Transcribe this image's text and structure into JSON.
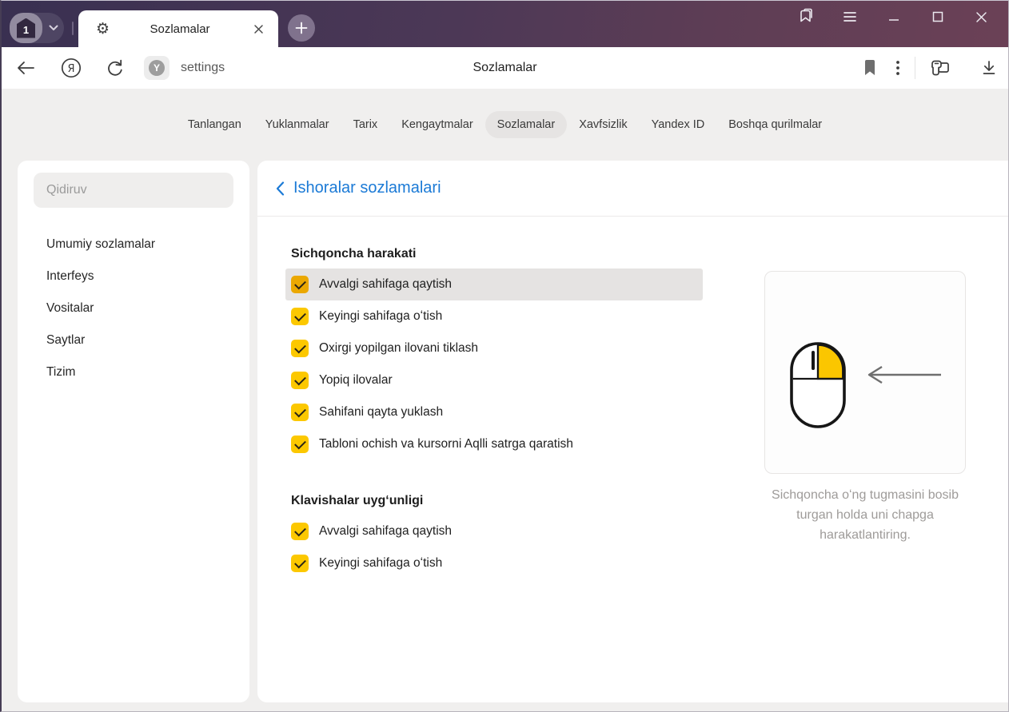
{
  "window": {
    "tab_count": "1",
    "tab_title": "Sozlamalar",
    "page_title": "Sozlamalar",
    "address": "settings"
  },
  "icons": {
    "gear": "⚙",
    "protect_letter": "Y",
    "yandex_letter": "Я"
  },
  "nav": {
    "items": [
      {
        "label": "Tanlangan",
        "active": false
      },
      {
        "label": "Yuklanmalar",
        "active": false
      },
      {
        "label": "Tarix",
        "active": false
      },
      {
        "label": "Kengaytmalar",
        "active": false
      },
      {
        "label": "Sozlamalar",
        "active": true
      },
      {
        "label": "Xavfsizlik",
        "active": false
      },
      {
        "label": "Yandex ID",
        "active": false
      },
      {
        "label": "Boshqa qurilmalar",
        "active": false
      }
    ]
  },
  "sidebar": {
    "search_placeholder": "Qidiruv",
    "items": [
      {
        "label": "Umumiy sozlamalar"
      },
      {
        "label": "Interfeys"
      },
      {
        "label": "Vositalar"
      },
      {
        "label": "Saytlar"
      },
      {
        "label": "Tizim"
      }
    ]
  },
  "main": {
    "back_title": "Ishoralar sozlamalari",
    "sections": [
      {
        "title": "Sichqoncha harakati",
        "items": [
          {
            "label": "Avvalgi sahifaga qaytish",
            "checked": true,
            "highlighted": true
          },
          {
            "label": "Keyingi sahifaga oʻtish",
            "checked": true,
            "highlighted": false
          },
          {
            "label": "Oxirgi yopilgan ilovani tiklash",
            "checked": true,
            "highlighted": false
          },
          {
            "label": "Yopiq ilovalar",
            "checked": true,
            "highlighted": false
          },
          {
            "label": "Sahifani qayta yuklash",
            "checked": true,
            "highlighted": false
          },
          {
            "label": "Tabloni ochish va kursorni Aqlli satrga qaratish",
            "checked": true,
            "highlighted": false
          }
        ]
      },
      {
        "title": "Klavishalar uygʻunligi",
        "items": [
          {
            "label": "Avvalgi sahifaga qaytish",
            "checked": true,
            "highlighted": false
          },
          {
            "label": "Keyingi sahifaga oʻtish",
            "checked": true,
            "highlighted": false
          }
        ]
      }
    ],
    "illustration_caption": "Sichqoncha oʻng tugmasini bosib turgan holda uni chapga harakatlantiring."
  },
  "colors": {
    "accent_blue": "#1b7ad6",
    "checkbox_gold": "#fcc800",
    "checkbox_gold_hover": "#eba801",
    "row_highlight": "#e5e3e2",
    "titlebar_gradient_left": "#393051",
    "titlebar_gradient_right": "#6b4156",
    "content_background": "#f0efee"
  }
}
